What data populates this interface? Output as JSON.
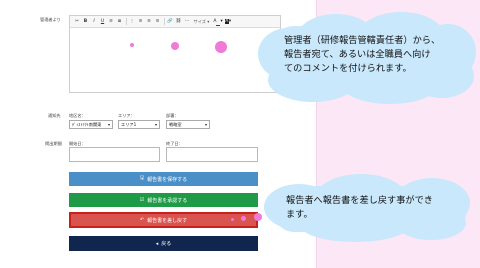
{
  "form": {
    "comment_label": "管理者より",
    "target_label": "通知先",
    "period_label": "掲出期間",
    "store_label": "地区名：",
    "store_value": "ﾃﾞｨｽﾄﾘｸﾄ南関東",
    "area_label": "エリア：",
    "area_value": "エリア1",
    "dept_label": "部署：",
    "dept_value": "戦略室",
    "start_label": "開始日：",
    "end_label": "終了日："
  },
  "toolbar": {
    "items": [
      "✂",
      "B",
      "I",
      "U",
      "≡",
      "≣",
      "⋮",
      "≡",
      "≡",
      "≡",
      "🔗",
      "⛓",
      "⋯"
    ],
    "size_label": "サイズ",
    "font_color_label": "A",
    "bg_color_label": "A"
  },
  "buttons": {
    "save": "報告書を保存する",
    "approve": "報告書を承認する",
    "return": "報告書を差し戻す",
    "back": "戻る"
  },
  "callouts": {
    "top": [
      "管理者（研修報告管轄責任者）から、",
      "報告者宛て、あるいは全職員へ向け",
      "てのコメントを付けられます。"
    ],
    "bottom": [
      "報告者へ報告書を差し戻す事ができ",
      "ます。"
    ]
  },
  "colors": {
    "save": "#4a8fc7",
    "approve": "#1f9a46",
    "return": "#d9534f",
    "back": "#10264f",
    "cloud": "#c9e8fb",
    "dot": "#f07ad8"
  }
}
